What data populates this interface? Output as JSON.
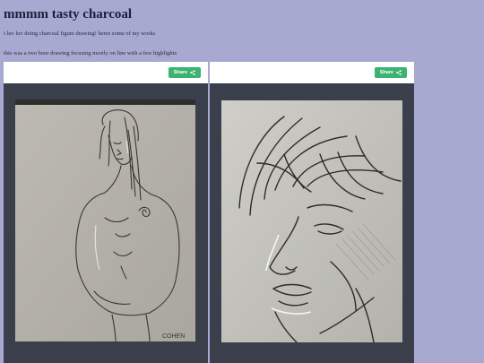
{
  "page": {
    "title": "mmmm tasty charcoal",
    "intro": "i luv luv doing charcoal figure drawing! heres some of my works",
    "caption": "this was a two hour drawing focusing mostly on line with a few highlights"
  },
  "posts": [
    {
      "share_label": "Share",
      "signature": "COHEN"
    },
    {
      "share_label": "Share"
    }
  ],
  "colors": {
    "background": "#a7a9d1",
    "share_button": "#3cb371",
    "frame": "#3b3f4b"
  }
}
